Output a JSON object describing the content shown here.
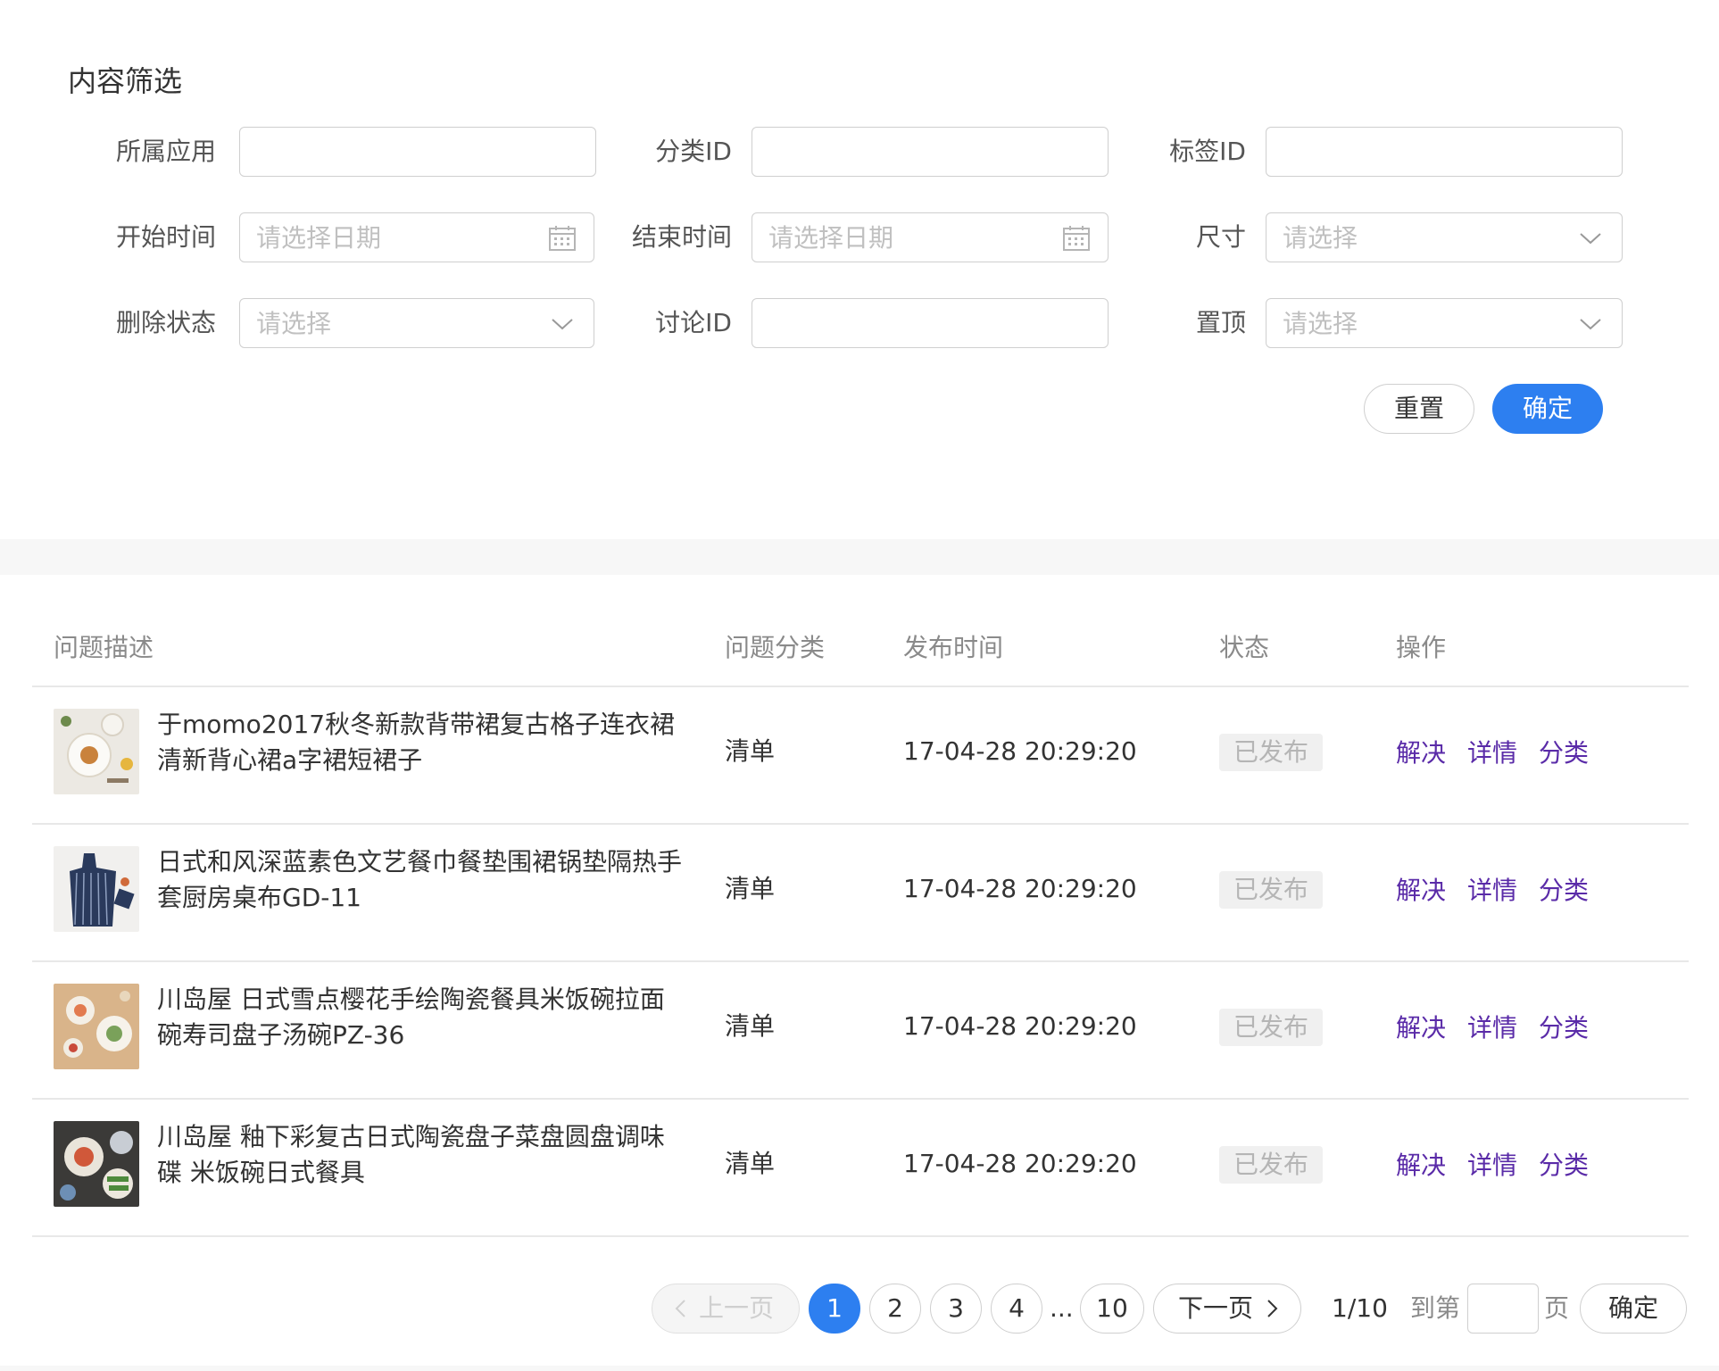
{
  "filter": {
    "title": "内容筛选",
    "fields": {
      "app": {
        "label": "所属应用",
        "value": ""
      },
      "category_id": {
        "label": "分类ID",
        "value": ""
      },
      "tag_id": {
        "label": "标签ID",
        "value": ""
      },
      "start_time": {
        "label": "开始时间",
        "placeholder": "请选择日期"
      },
      "end_time": {
        "label": "结束时间",
        "placeholder": "请选择日期"
      },
      "size": {
        "label": "尺寸",
        "placeholder": "请选择"
      },
      "delete_status": {
        "label": "删除状态",
        "placeholder": "请选择"
      },
      "discussion_id": {
        "label": "讨论ID",
        "value": ""
      },
      "pinned": {
        "label": "置顶",
        "placeholder": "请选择"
      }
    },
    "reset_label": "重置",
    "confirm_label": "确定"
  },
  "table": {
    "headers": [
      "问题描述",
      "问题分类",
      "发布时间",
      "状态",
      "操作"
    ],
    "rows": [
      {
        "description": "于momo2017秋冬新款背带裙复古格子连衣裙清新背心裙a字裙短裙子",
        "category": "清单",
        "time": "17-04-28 20:29:20",
        "status": "已发布",
        "thumb": "plates-icon"
      },
      {
        "description": "日式和风深蓝素色文艺餐巾餐垫围裙锅垫隔热手套厨房桌布GD-11",
        "category": "清单",
        "time": "17-04-28 20:29:20",
        "status": "已发布",
        "thumb": "apron-icon"
      },
      {
        "description": "川岛屋 日式雪点樱花手绘陶瓷餐具米饭碗拉面碗寿司盘子汤碗PZ-36",
        "category": "清单",
        "time": "17-04-28 20:29:20",
        "status": "已发布",
        "thumb": "tableware-icon"
      },
      {
        "description": "川岛屋 釉下彩复古日式陶瓷盘子菜盘圆盘调味碟 米饭碗日式餐具",
        "category": "清单",
        "time": "17-04-28 20:29:20",
        "status": "已发布",
        "thumb": "dishes-icon"
      }
    ],
    "actions": [
      "解决",
      "详情",
      "分类"
    ]
  },
  "pagination": {
    "prev_label": "上一页",
    "pages": [
      "1",
      "2",
      "3",
      "4"
    ],
    "ellipsis": "...",
    "last_page": "10",
    "next_label": "下一页",
    "current_page": 1,
    "page_info": "1/10",
    "goto_label": "到第",
    "page_unit": "页",
    "confirm_label": "确定"
  },
  "colors": {
    "primary": "#2d7ff0",
    "action_link": "#5a2ba8"
  }
}
